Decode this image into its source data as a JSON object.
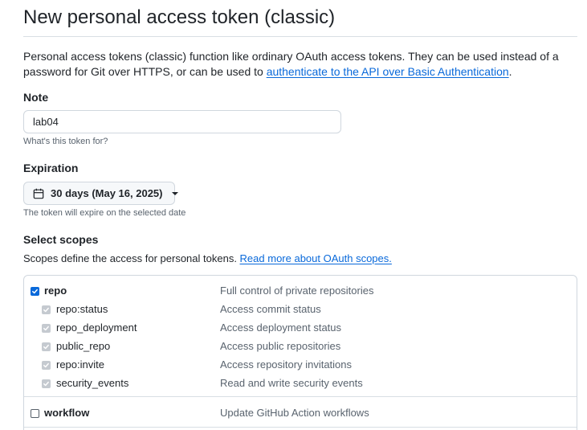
{
  "page": {
    "title": "New personal access token (classic)"
  },
  "intro": {
    "text_before": "Personal access tokens (classic) function like ordinary OAuth access tokens. They can be used instead of a password for Git over HTTPS, or can be used to ",
    "link_text": "authenticate to the API over Basic Authentication",
    "text_after": "."
  },
  "note": {
    "label": "Note",
    "value": "lab04",
    "hint": "What's this token for?"
  },
  "expiration": {
    "label": "Expiration",
    "selected": "30 days (May 16, 2025)",
    "icon": "calendar-icon",
    "hint": "The token will expire on the selected date"
  },
  "scopes": {
    "label": "Select scopes",
    "description": "Scopes define the access for personal tokens. ",
    "link_text": "Read more about OAuth scopes.",
    "items": [
      {
        "name": "repo",
        "description": "Full control of private repositories",
        "checked": true,
        "sub": false
      },
      {
        "name": "repo:status",
        "description": "Access commit status",
        "checked": true,
        "sub": true
      },
      {
        "name": "repo_deployment",
        "description": "Access deployment status",
        "checked": true,
        "sub": true
      },
      {
        "name": "public_repo",
        "description": "Access public repositories",
        "checked": true,
        "sub": true
      },
      {
        "name": "repo:invite",
        "description": "Access repository invitations",
        "checked": true,
        "sub": true
      },
      {
        "name": "security_events",
        "description": "Read and write security events",
        "checked": true,
        "sub": true
      },
      {
        "name": "workflow",
        "description": "Update GitHub Action workflows",
        "checked": false,
        "sub": false
      }
    ]
  },
  "colors": {
    "accent": "#0969da",
    "text": "#1f2328",
    "muted": "#59636e",
    "border": "#d0d7de"
  }
}
